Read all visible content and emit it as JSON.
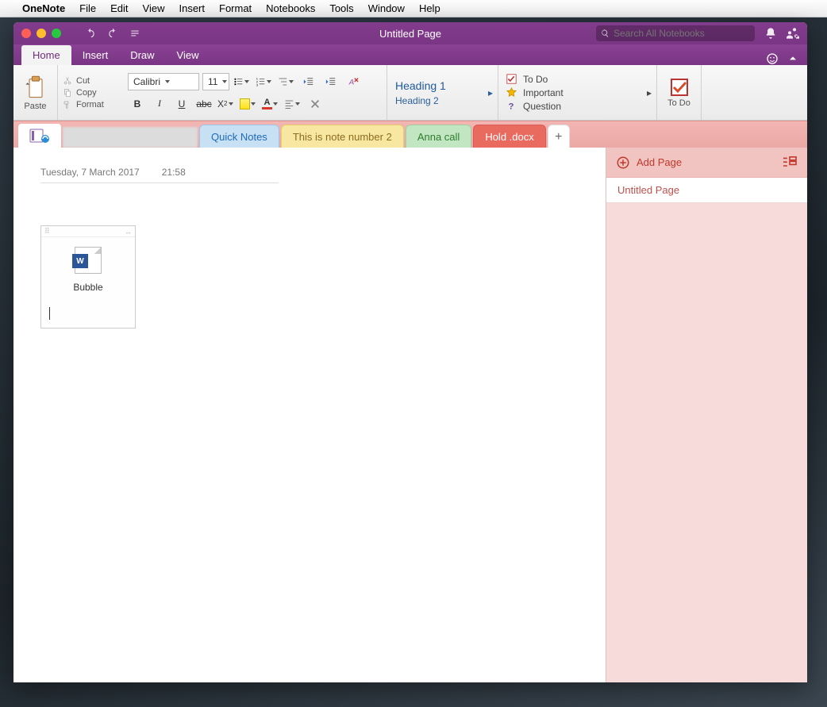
{
  "mac_menu": {
    "app": "OneNote",
    "items": [
      "File",
      "Edit",
      "View",
      "Insert",
      "Format",
      "Notebooks",
      "Tools",
      "Window",
      "Help"
    ]
  },
  "window": {
    "title": "Untitled Page",
    "search_placeholder": "Search All Notebooks"
  },
  "ribbon_tabs": [
    "Home",
    "Insert",
    "Draw",
    "View"
  ],
  "ribbon_active": 0,
  "clipboard": {
    "paste": "Paste",
    "cut": "Cut",
    "copy": "Copy",
    "format": "Format"
  },
  "font": {
    "name": "Calibri",
    "size": "11"
  },
  "styles": {
    "h1": "Heading 1",
    "h2": "Heading 2"
  },
  "tags": {
    "todo": "To Do",
    "important": "Important",
    "question": "Question"
  },
  "todo_btn": "To Do",
  "section_tabs": [
    {
      "label": "Quick Notes",
      "color": "blue"
    },
    {
      "label": "This is note number 2",
      "color": "yellow"
    },
    {
      "label": "Anna call",
      "color": "green"
    },
    {
      "label": "Hold .docx",
      "color": "red"
    }
  ],
  "page": {
    "date": "Tuesday, 7 March 2017",
    "time": "21:58",
    "attachment_name": "Bubble",
    "attachment_glyph": "W"
  },
  "sidepanel": {
    "add_page": "Add Page",
    "pages": [
      "Untitled Page"
    ]
  }
}
